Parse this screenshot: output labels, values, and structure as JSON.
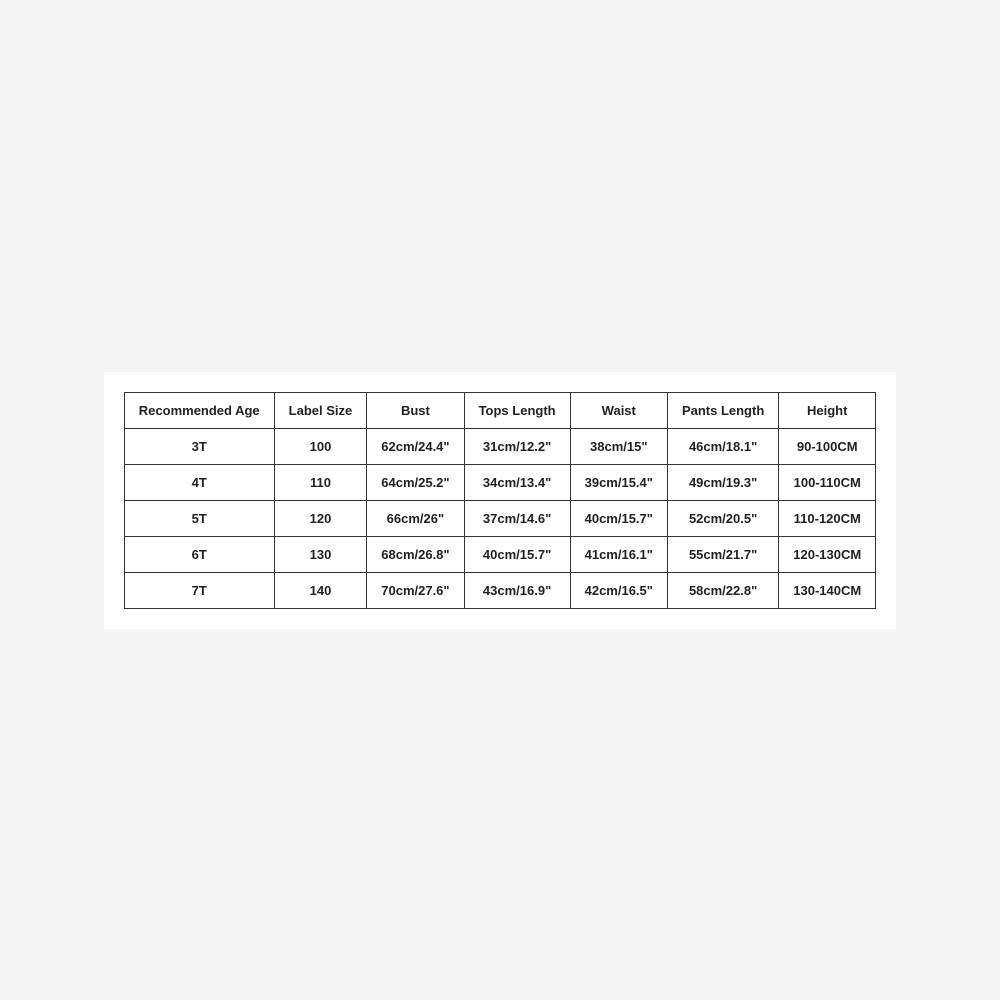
{
  "table": {
    "headers": [
      "Recommended Age",
      "Label Size",
      "Bust",
      "Tops Length",
      "Waist",
      "Pants Length",
      "Height"
    ],
    "rows": [
      [
        "3T",
        "100",
        "62cm/24.4\"",
        "31cm/12.2\"",
        "38cm/15\"",
        "46cm/18.1\"",
        "90-100CM"
      ],
      [
        "4T",
        "110",
        "64cm/25.2\"",
        "34cm/13.4\"",
        "39cm/15.4\"",
        "49cm/19.3\"",
        "100-110CM"
      ],
      [
        "5T",
        "120",
        "66cm/26\"",
        "37cm/14.6\"",
        "40cm/15.7\"",
        "52cm/20.5\"",
        "110-120CM"
      ],
      [
        "6T",
        "130",
        "68cm/26.8\"",
        "40cm/15.7\"",
        "41cm/16.1\"",
        "55cm/21.7\"",
        "120-130CM"
      ],
      [
        "7T",
        "140",
        "70cm/27.6\"",
        "43cm/16.9\"",
        "42cm/16.5\"",
        "58cm/22.8\"",
        "130-140CM"
      ]
    ]
  }
}
